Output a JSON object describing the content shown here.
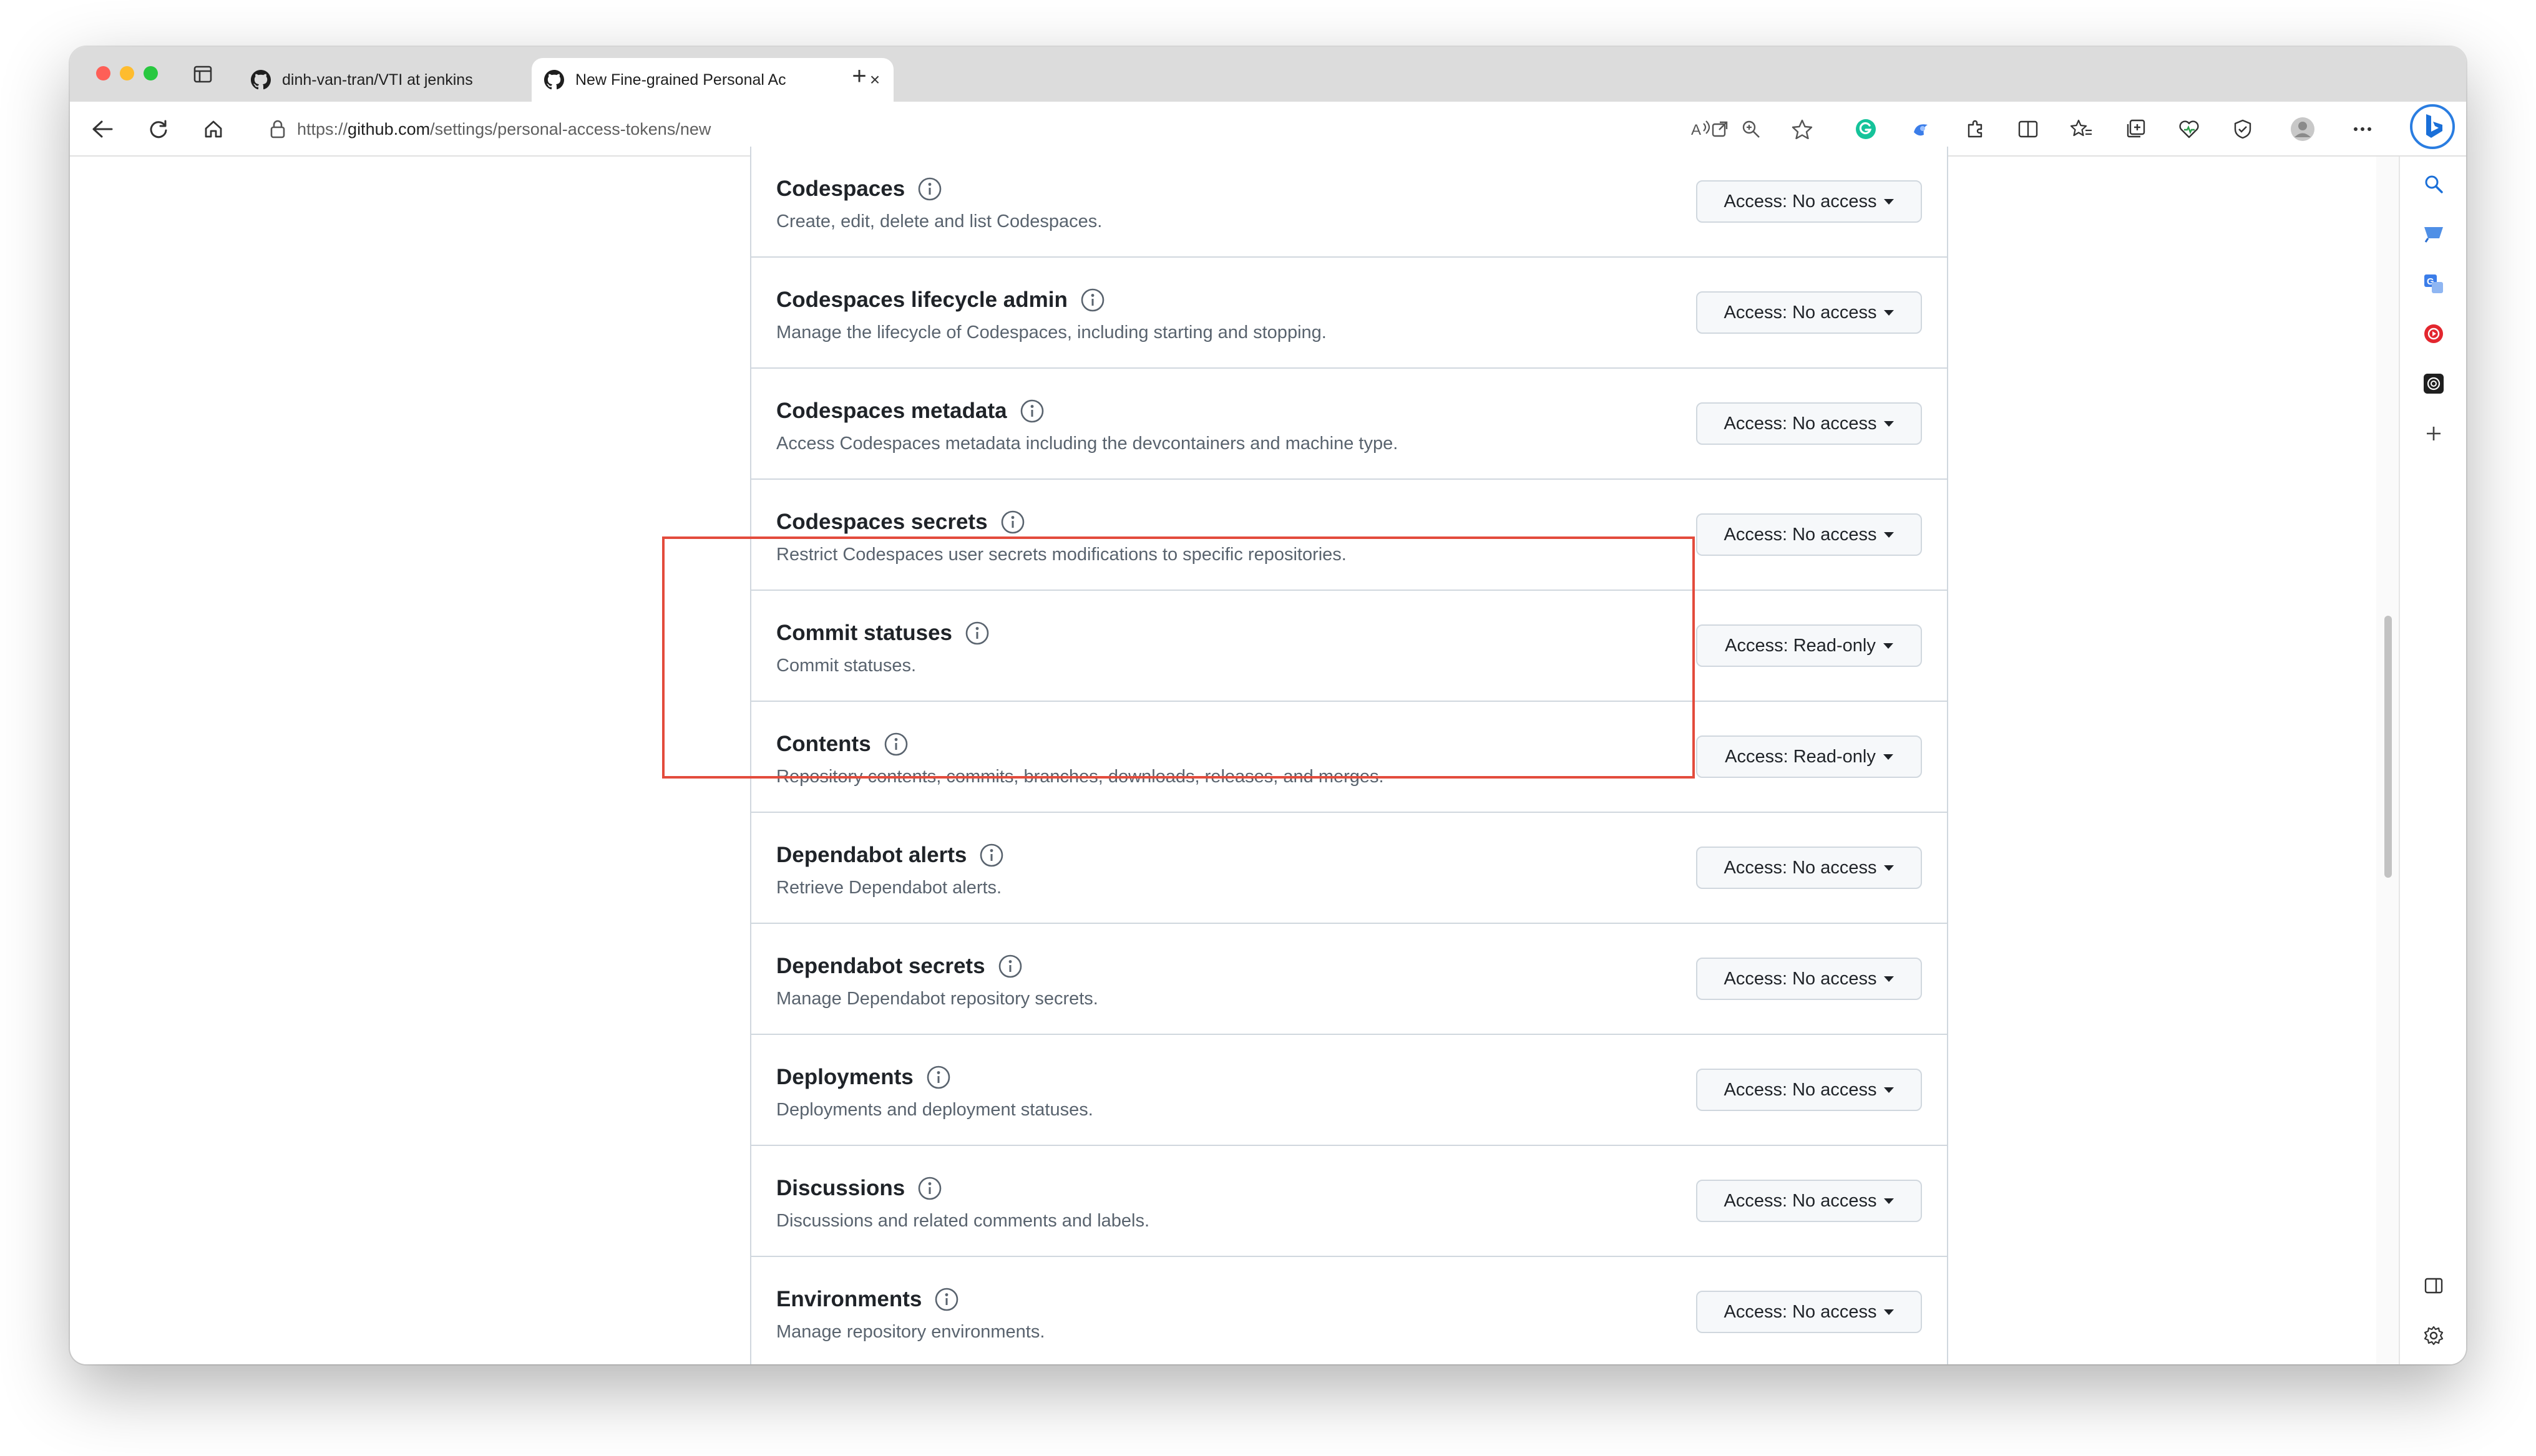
{
  "browser": {
    "tabs": [
      {
        "title": "dinh-van-tran/VTI at jenkins",
        "active": false
      },
      {
        "title": "New Fine-grained Personal Ac",
        "active": true
      }
    ],
    "url_prefix": "https://",
    "url_host": "github.com",
    "url_path": "/settings/personal-access-tokens/new",
    "icons": {
      "close": "×",
      "new_tab": "+"
    }
  },
  "permissions": [
    {
      "name": "Codespaces",
      "description": "Create, edit, delete and list Codespaces.",
      "access": "Access: No access"
    },
    {
      "name": "Codespaces lifecycle admin",
      "description": "Manage the lifecycle of Codespaces, including starting and stopping.",
      "access": "Access: No access"
    },
    {
      "name": "Codespaces metadata",
      "description": "Access Codespaces metadata including the devcontainers and machine type.",
      "access": "Access: No access"
    },
    {
      "name": "Codespaces secrets",
      "description": "Restrict Codespaces user secrets modifications to specific repositories.",
      "access": "Access: No access"
    },
    {
      "name": "Commit statuses",
      "description": "Commit statuses.",
      "access": "Access: Read-only",
      "highlighted": true
    },
    {
      "name": "Contents",
      "description": "Repository contents, commits, branches, downloads, releases, and merges.",
      "access": "Access: Read-only",
      "highlighted": true
    },
    {
      "name": "Dependabot alerts",
      "description": "Retrieve Dependabot alerts.",
      "access": "Access: No access"
    },
    {
      "name": "Dependabot secrets",
      "description": "Manage Dependabot repository secrets.",
      "access": "Access: No access"
    },
    {
      "name": "Deployments",
      "description": "Deployments and deployment statuses.",
      "access": "Access: No access"
    },
    {
      "name": "Discussions",
      "description": "Discussions and related comments and labels.",
      "access": "Access: No access"
    },
    {
      "name": "Environments",
      "description": "Manage repository environments.",
      "access": "Access: No access"
    }
  ],
  "colors": {
    "highlight_border": "#e34b3c",
    "text_primary": "#1f2328",
    "text_muted": "#59636e",
    "border": "#d0d7de",
    "button_bg": "#f6f8fa"
  }
}
